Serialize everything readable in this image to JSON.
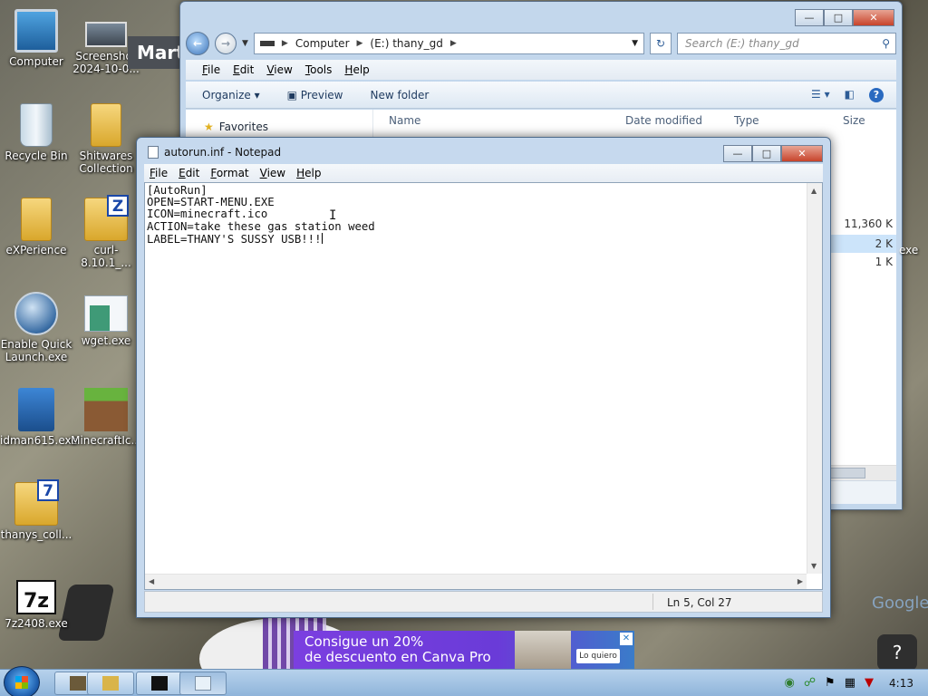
{
  "desktop": {
    "icons": [
      {
        "label": "Computer"
      },
      {
        "label": "Screenshot 2024-10-0..."
      },
      {
        "label": "Recycle Bin"
      },
      {
        "label": "Shitwares Collection"
      },
      {
        "label": "eXPerience"
      },
      {
        "label": "curl-8.10.1_..."
      },
      {
        "label": "Enable Quick Launch.exe"
      },
      {
        "label": "wget.exe"
      },
      {
        "label": "idman615.exe"
      },
      {
        "label": "MinecraftIc..."
      },
      {
        "label": "thanys_coll..."
      },
      {
        "label": "7z2408.exe"
      }
    ],
    "partial_window_title": "Martx",
    "exe_tail": "exe"
  },
  "explorer": {
    "address": [
      "Computer",
      "(E:) thany_gd"
    ],
    "search_placeholder": "Search (E:) thany_gd",
    "menu": [
      "File",
      "Edit",
      "View",
      "Tools",
      "Help"
    ],
    "commands": {
      "organize": "Organize",
      "preview": "Preview",
      "new_folder": "New folder"
    },
    "favorites": "Favorites",
    "columns": {
      "name": "Name",
      "date_modified": "Date modified",
      "type": "Type",
      "size": "Size"
    },
    "sizes": [
      "11,360 K",
      "2 K",
      "1 K"
    ]
  },
  "notepad": {
    "title": "autorun.inf - Notepad",
    "menu": [
      "File",
      "Edit",
      "Format",
      "View",
      "Help"
    ],
    "lines": [
      "[AutoRun]",
      "OPEN=START-MENU.EXE",
      "ICON=minecraft.ico",
      "ACTION=take these gas station weed",
      "LABEL=THANY'S SUSSY USB!!!"
    ],
    "status": "Ln 5, Col 27"
  },
  "ad": {
    "line1": "Consigue un 20%",
    "line2": "de descuento en Canva Pro",
    "cta": "Lo quiero"
  },
  "overlay": {
    "google": "Google",
    "help": "?"
  },
  "taskbar": {
    "clock": "4:13"
  }
}
